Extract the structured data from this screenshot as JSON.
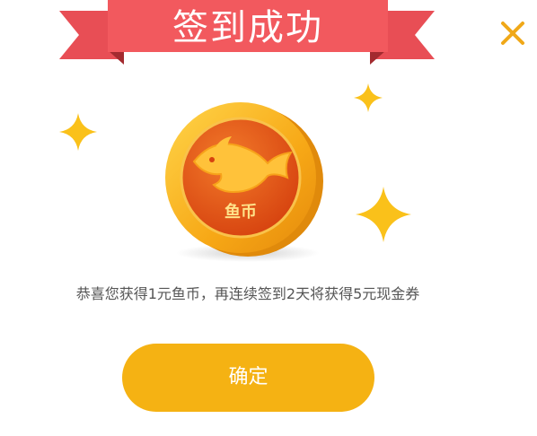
{
  "dialog": {
    "title": "签到成功",
    "coin_label": "鱼币",
    "message": "恭喜您获得1元鱼币，再连续签到2天将获得5元现金券",
    "confirm_label": "确定",
    "close_icon": "close-icon"
  },
  "colors": {
    "ribbon_red": "#e84e55",
    "ribbon_dark": "#c0363c",
    "accent_yellow": "#f5b213",
    "close_orange": "#f0a818",
    "sparkle_yellow": "#fac11a",
    "coin_outer": "#f6b21c",
    "coin_inner": "#e5601c"
  }
}
